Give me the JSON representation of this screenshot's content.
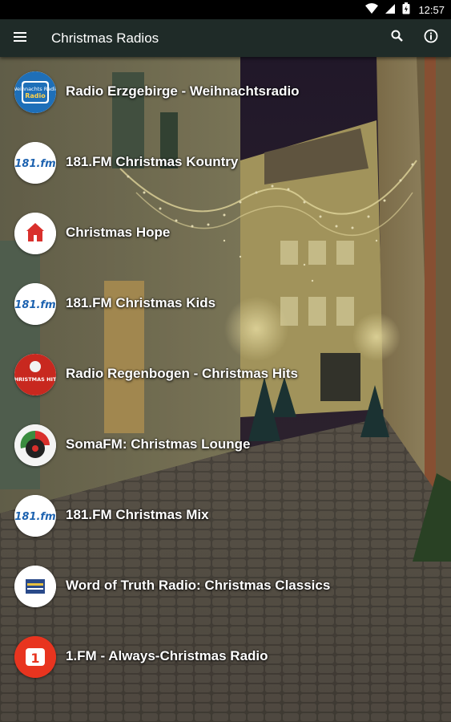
{
  "status_bar": {
    "time": "12:57"
  },
  "app_bar": {
    "title": "Christmas Radios",
    "icons": [
      "menu-icon",
      "search-icon",
      "info-icon"
    ]
  },
  "stations": [
    {
      "name": "Radio Erzgebirge - Weihnachtsradio",
      "logo": "radio-erzgebirge-logo",
      "logo_text": "Weihnachts Radio",
      "accent": "#1e6fb8"
    },
    {
      "name": "181.FM Christmas Kountry",
      "logo": "181fm-logo",
      "logo_text": "181.fm",
      "accent": "#1e63b0"
    },
    {
      "name": "Christmas Hope",
      "logo": "christmas-hope-logo",
      "logo_text": "",
      "accent": "#d9302c"
    },
    {
      "name": "181.FM Christmas Kids",
      "logo": "181fm-logo",
      "logo_text": "181.fm",
      "accent": "#1e63b0"
    },
    {
      "name": "Radio Regenbogen - Christmas Hits",
      "logo": "regenbogen-logo",
      "logo_text": "CHRISTMAS HITS",
      "accent": "#c8281f"
    },
    {
      "name": "SomaFM: Christmas Lounge",
      "logo": "somafm-logo",
      "logo_text": "",
      "accent": "#3a8c3f"
    },
    {
      "name": "181.FM Christmas Mix",
      "logo": "181fm-logo",
      "logo_text": "181.fm",
      "accent": "#1e63b0"
    },
    {
      "name": "Word of Truth Radio: Christmas Classics",
      "logo": "word-of-truth-logo",
      "logo_text": "",
      "accent": "#2a4a8a"
    },
    {
      "name": "1.FM - Always-Christmas Radio",
      "logo": "1fm-logo",
      "logo_text": "1 FM",
      "accent": "#e8341f"
    }
  ]
}
